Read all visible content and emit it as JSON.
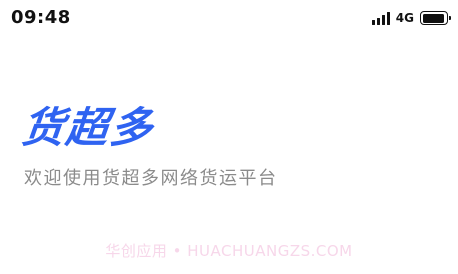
{
  "status_bar": {
    "time": "09:48",
    "network": "4G",
    "signal_bars": 4,
    "battery_level": 0.95,
    "signal_icon": "cellular-signal-icon",
    "battery_icon": "battery-icon"
  },
  "splash": {
    "logo_text": "货超多",
    "slogan": "欢迎使用货超多网络货运平台",
    "brand_color": "#2f63f1",
    "slogan_color": "#8b8b8b"
  },
  "watermark": {
    "text": "华创应用 • HUACHUANGZS.COM"
  }
}
